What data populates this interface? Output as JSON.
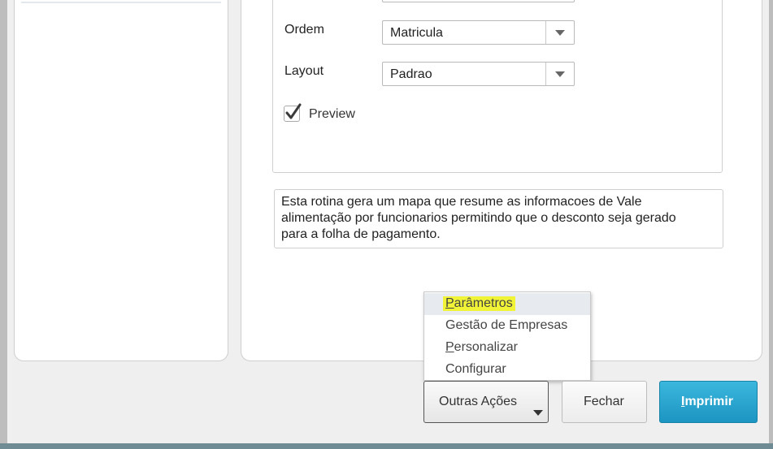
{
  "form": {
    "ordem_label": "Ordem",
    "ordem_value": "Matricula",
    "layout_label": "Layout",
    "layout_value": "Padrao",
    "preview_label": "Preview",
    "preview_checked": true
  },
  "description": {
    "line1": "Esta rotina gera um mapa que resume as informacoes de Vale",
    "line2": "alimentação por  funcionarios permitindo que o desconto seja gerado",
    "line3": "para a folha de pagamento."
  },
  "menu": {
    "items": [
      {
        "first": "P",
        "rest": "arâmetros",
        "highlighted": true
      },
      {
        "first": "",
        "rest": "Gestão de Empresas",
        "highlighted": false
      },
      {
        "first": "P",
        "rest": "ersonalizar",
        "highlighted": false
      },
      {
        "first": "",
        "rest": "Configurar",
        "highlighted": false
      }
    ]
  },
  "buttons": {
    "outras_acoes": "Outras Ações",
    "fechar": "Fechar",
    "imprimir_first": "I",
    "imprimir_rest": "mprimir"
  },
  "colors": {
    "primary_button": "#1c95c2",
    "highlight": "#f1f336"
  },
  "icons": [
    "dropdown-arrow-icon",
    "checkmark-icon",
    "caret-down-icon"
  ]
}
